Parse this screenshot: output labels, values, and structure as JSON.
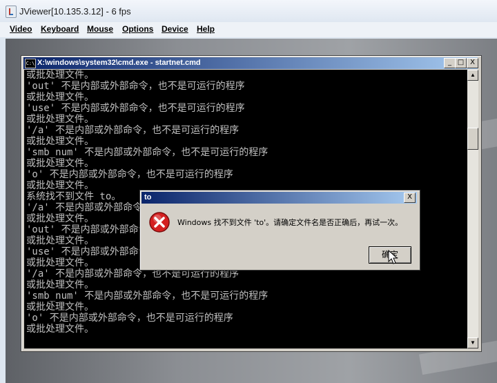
{
  "viewer": {
    "title": "JViewer[10.135.3.12] - 6 fps",
    "menu": [
      "Video",
      "Keyboard",
      "Mouse",
      "Options",
      "Device",
      "Help"
    ]
  },
  "cmd": {
    "icon_label": "C:\\",
    "title": "X:\\windows\\system32\\cmd.exe - startnet.cmd",
    "buttons": {
      "minimize": "_",
      "maximize": "□",
      "close": "X"
    },
    "lines": [
      "或批处理文件。",
      "'out' 不是内部或外部命令，也不是可运行的程序",
      "或批处理文件。",
      "'use' 不是内部或外部命令，也不是可运行的程序",
      "或批处理文件。",
      "'/a' 不是内部或外部命令，也不是可运行的程序",
      "或批处理文件。",
      "'smb_num' 不是内部或外部命令，也不是可运行的程序",
      "或批处理文件。",
      "'o' 不是内部或外部命令，也不是可运行的程序",
      "或批处理文件。",
      "系统找不到文件 to。",
      "'/a' 不是内部或外部命令，也不是可运行的程序",
      "或批处理文件。",
      "'out' 不是内部或外部命令，也不是可运行的程序",
      "或批处理文件。",
      "'use' 不是内部或外部命令，也不是可运行的程序",
      "或批处理文件。",
      "'/a' 不是内部或外部命令，也不是可运行的程序",
      "或批处理文件。",
      "'smb_num' 不是内部或外部命令，也不是可运行的程序",
      "或批处理文件。",
      "'o' 不是内部或外部命令，也不是可运行的程序",
      "或批处理文件。"
    ]
  },
  "dialog": {
    "title": "to",
    "close": "X",
    "message": "Windows 找不到文件 'to'。请确定文件名是否正确后，再试一次。",
    "ok_label": "确定"
  },
  "colors": {
    "titlebar_active": "#0a246a",
    "console_bg": "#000000",
    "console_text": "#c0c0c0",
    "error_red": "#d42020"
  }
}
